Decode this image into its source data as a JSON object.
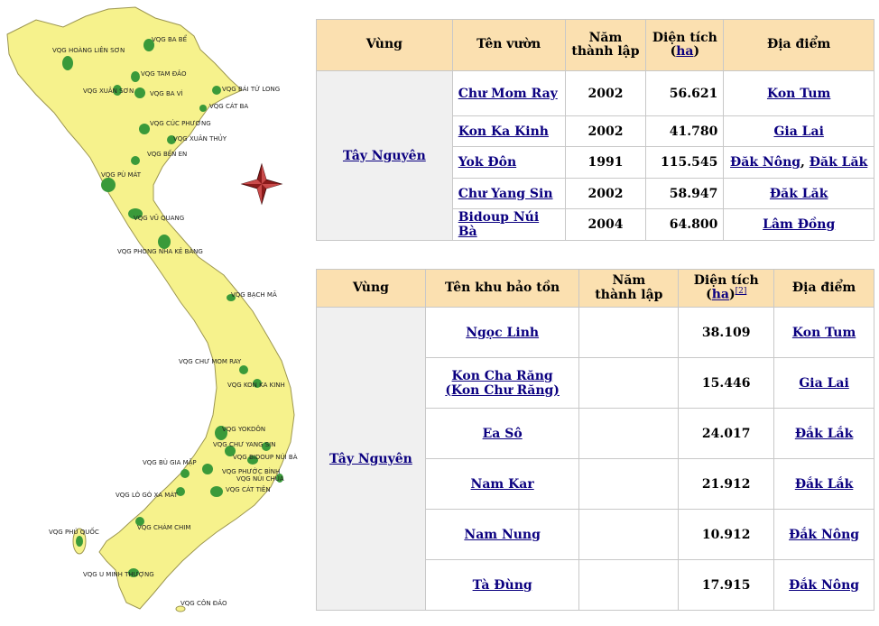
{
  "map": {
    "labels": [
      "VQG HOÀNG LIÊN SƠN",
      "VQG BA BỂ",
      "VQG TAM ĐẢO",
      "VQG BÁI TỬ LONG",
      "VQG XUÂN SƠN",
      "VQG BA VÌ",
      "VQG CÁT BA",
      "VQG CÚC PHƯƠNG",
      "VQG XUÂN THỦY",
      "VQG BẾN EN",
      "VQG PÙ MÁT",
      "VQG VŨ QUANG",
      "VQG PHONG NHA KẺ BÀNG",
      "VQG BẠCH MÃ",
      "VQG CHƯ MOM RAY",
      "VQG KON KA KINH",
      "VQG YOKDÔN",
      "VQG CHƯ YANG SIN",
      "VQG BIDOUP NÚI BÀ",
      "VQG BÙ GIA MẬP",
      "VQG PHƯỚC BÌNH",
      "VQG LÒ GÒ XA MÁT",
      "VQG CÁT TIÊN",
      "VQG NÚI CHÚA",
      "VQG CHÀM CHIM",
      "VQG PHÚ QUỐC",
      "VQG U MINH THƯỢNG",
      "VQG CÔN ĐẢO"
    ],
    "colors": {
      "land": "#f6f28c",
      "park": "#3a9a3a",
      "sea": "#ffffff",
      "compass": "#8b1a1a"
    }
  },
  "table1": {
    "headers": {
      "region": "Vùng",
      "name": "Tên vườn",
      "year_l1": "Năm",
      "year_l2": "thành lập",
      "area_l1": "Diện tích",
      "area_open": "(",
      "area_unit": "ha",
      "area_close": ")",
      "location": "Địa điểm"
    },
    "region": "Tây Nguyên",
    "rows": [
      {
        "name": "Chư Mom Ray",
        "year": "2002",
        "area": "56.621",
        "loc1": "Kon Tum",
        "sep": "",
        "loc2": ""
      },
      {
        "name": "Kon Ka Kinh",
        "year": "2002",
        "area": "41.780",
        "loc1": "Gia Lai",
        "sep": "",
        "loc2": ""
      },
      {
        "name": "Yok Đôn",
        "year": "1991",
        "area": "115.545",
        "loc1": "Đăk Nông",
        "sep": ", ",
        "loc2": "Đăk Lăk"
      },
      {
        "name": "Chư Yang Sin",
        "year": "2002",
        "area": "58.947",
        "loc1": "Đăk Lăk",
        "sep": "",
        "loc2": ""
      },
      {
        "name": "Bidoup Núi Bà",
        "year": "2004",
        "area": "64.800",
        "loc1": "Lâm Đồng",
        "sep": "",
        "loc2": ""
      }
    ]
  },
  "table2": {
    "headers": {
      "region": "Vùng",
      "name": "Tên khu bảo tồn",
      "year_l1": "Năm",
      "year_l2": "thành lập",
      "area_l1": "Diện tích",
      "area_open": "(",
      "area_unit": "ha",
      "area_close": ")",
      "area_ref": "[2]",
      "location": "Địa điểm"
    },
    "region": "Tây Nguyên",
    "rows": [
      {
        "name1": "Ngọc Linh",
        "name2": "",
        "year": "",
        "area": "38.109",
        "loc": "Kon Tum"
      },
      {
        "name1": "Kon Cha Răng",
        "name2": "(Kon Chư Răng)",
        "year": "",
        "area": "15.446",
        "loc": "Gia Lai"
      },
      {
        "name1": "Ea Sô",
        "name2": "",
        "year": "",
        "area": "24.017",
        "loc": "Đắk Lắk"
      },
      {
        "name1": "Nam Kar",
        "name2": "",
        "year": "",
        "area": "21.912",
        "loc": "Đắk Lắk"
      },
      {
        "name1": "Nam Nung",
        "name2": "",
        "year": "",
        "area": "10.912",
        "loc": "Đắk Nông"
      },
      {
        "name1": "Tà Đùng",
        "name2": "",
        "year": "",
        "area": "17.915",
        "loc": "Đắk Nông"
      }
    ]
  }
}
